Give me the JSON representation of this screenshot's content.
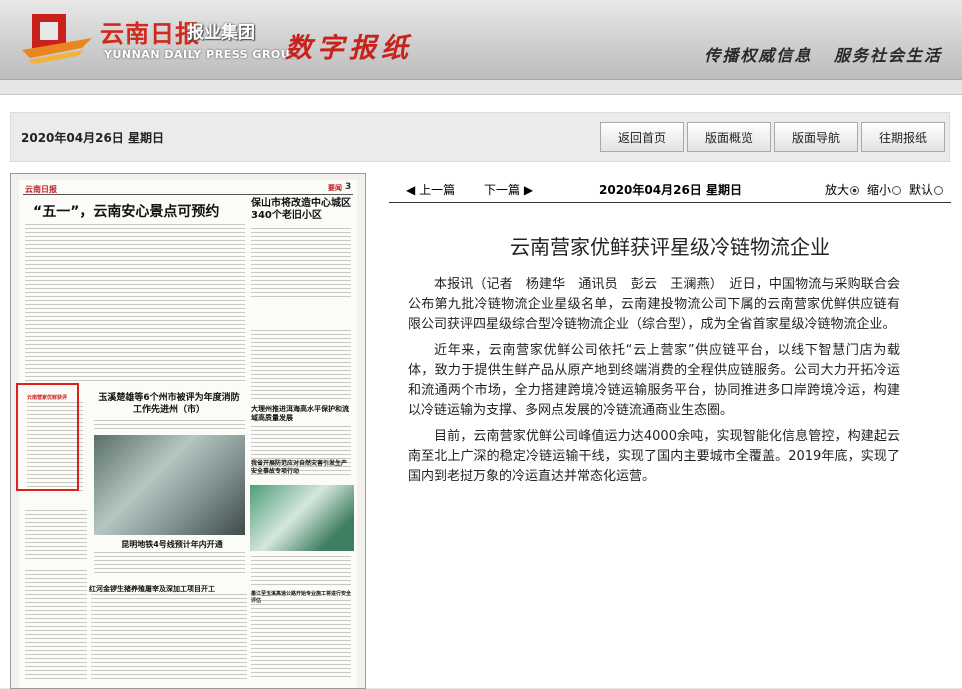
{
  "header": {
    "logo_cn": "云南日报",
    "logo_group": "报业集团",
    "logo_en": "YUNNAN DAILY PRESS GROUP",
    "site_title": "数字报纸",
    "slogan": "传播权威信息  服务社会生活"
  },
  "datebar": {
    "date": "2020年04月26日  星期日"
  },
  "nav": [
    {
      "label": "返回首页"
    },
    {
      "label": "版面概览"
    },
    {
      "label": "版面导航"
    },
    {
      "label": "往期报纸"
    }
  ],
  "thumbnail": {
    "masthead": "云南日报",
    "section": "要闻",
    "page_no": "3",
    "headline_main": "“五一”，云南安心景点可预约",
    "headline_right": "保山市将改造中心城区340个老旧小区",
    "headline_mid": "玉溪楚雄等6个州市被评为年度消防工作先进州（市）",
    "headline_dali": "大理州推进洱海高水平保护和流域高质量发展",
    "headline_safety": "我省开展防范应对自然灾害引发生产安全事故专项行动",
    "headline_metro": "昆明地铁4号线预计年内开通",
    "headline_pig": "红河金锣生猪养殖屠宰及深加工项目开工",
    "headline_road": "墨江至玉溪高速公路开始专业施工将进行安全评估"
  },
  "article_bar": {
    "prev": "上一篇",
    "next": "下一篇",
    "date": "2020年04月26日  星期日",
    "zoom_in": "放大",
    "zoom_out": "缩小",
    "zoom_default": "默认"
  },
  "article": {
    "title": "云南营家优鲜获评星级冷链物流企业",
    "paragraphs": [
      "本报讯（记者　杨建华　通讯员　彭云　王澜燕）　近日，中国物流与采购联合会公布第九批冷链物流企业星级名单，云南建投物流公司下属的云南营家优鲜供应链有限公司获评四星级综合型冷链物流企业（综合型），成为全省首家星级冷链物流企业。",
      "近年来，云南营家优鲜公司依托“云上营家”供应链平台，以线下智慧门店为载体，致力于提供生鲜产品从原产地到终端消费的全程供应链服务。公司大力开拓冷运和流通两个市场，全力搭建跨境冷链运输服务平台，协同推进多口岸跨境冷运，构建以冷链运输为支撑、多网点发展的冷链流通商业生态圈。",
      "目前，云南营家优鲜公司峰值运力达4000余吨，实现智能化信息管控，构建起云南至北上广深的稳定冷链运输干线，实现了国内主要城市全覆盖。2019年底，实现了国内到老挝万象的冷运直达并常态化运营。"
    ]
  },
  "colors": {
    "brand_red": "#d12a1d",
    "highlight": "#e02020"
  }
}
